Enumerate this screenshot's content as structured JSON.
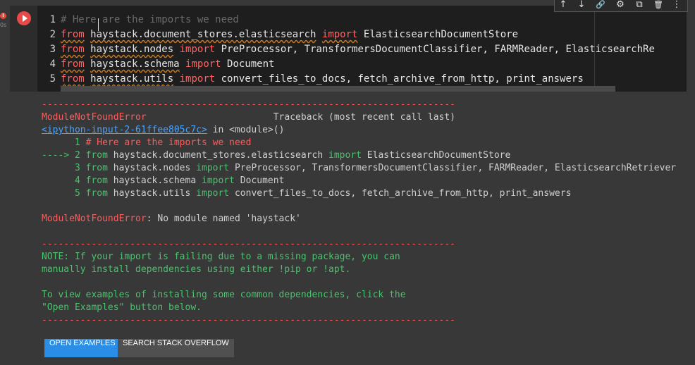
{
  "cell": {
    "warning_badge": "!",
    "exec_time": "0s",
    "code_lines": [
      {
        "num": "1",
        "parts": [
          {
            "cls": "cmt",
            "text": "# Here are the imports we need"
          }
        ]
      },
      {
        "num": "2",
        "parts": [
          {
            "cls": "kw",
            "text": "from"
          },
          {
            "cls": "id",
            "text": " "
          },
          {
            "cls": "mod",
            "text": "haystack.document_stores.elasticsearch"
          },
          {
            "cls": "id",
            "text": " "
          },
          {
            "cls": "kw",
            "text": "import"
          },
          {
            "cls": "id",
            "text": " ElasticsearchDocumentStore"
          }
        ]
      },
      {
        "num": "3",
        "parts": [
          {
            "cls": "kw",
            "text": "from"
          },
          {
            "cls": "id",
            "text": " "
          },
          {
            "cls": "mod",
            "text": "haystack.nodes"
          },
          {
            "cls": "id",
            "text": " "
          },
          {
            "cls": "kw2",
            "text": "import"
          },
          {
            "cls": "id",
            "text": " PreProcessor, TransformersDocumentClassifier, FARMReader, ElasticsearchRe"
          }
        ]
      },
      {
        "num": "4",
        "parts": [
          {
            "cls": "kw",
            "text": "from"
          },
          {
            "cls": "id",
            "text": " "
          },
          {
            "cls": "mod",
            "text": "haystack.schema"
          },
          {
            "cls": "id",
            "text": " "
          },
          {
            "cls": "kw2",
            "text": "import"
          },
          {
            "cls": "id",
            "text": " Document"
          }
        ]
      },
      {
        "num": "5",
        "parts": [
          {
            "cls": "kw",
            "text": "from"
          },
          {
            "cls": "id",
            "text": " "
          },
          {
            "cls": "mod",
            "text": "haystack.utils"
          },
          {
            "cls": "id",
            "text": " "
          },
          {
            "cls": "kw2",
            "text": "import"
          },
          {
            "cls": "id",
            "text": " convert_files_to_docs, fetch_archive_from_http, print_answers"
          }
        ]
      }
    ]
  },
  "toolbar": {
    "move_up": "↑",
    "move_down": "↓",
    "link": "🔗",
    "settings": "⚙",
    "mirror": "⧉",
    "delete": "🗑",
    "more": "⋮"
  },
  "output": {
    "lines": [
      {
        "parts": [
          {
            "cls": "red",
            "text": "---------------------------------------------------------------------------"
          }
        ]
      },
      {
        "parts": [
          {
            "cls": "red",
            "text": "ModuleNotFoundError"
          },
          {
            "cls": "gray",
            "text": "                       Traceback (most recent call last)"
          }
        ]
      },
      {
        "parts": [
          {
            "cls": "link",
            "text": "<ipython-input-2-61ffee805c7c>"
          },
          {
            "cls": "gray",
            "text": " in "
          },
          {
            "cls": "gray",
            "text": "<module>()"
          }
        ]
      },
      {
        "parts": [
          {
            "cls": "green",
            "text": "      1 "
          },
          {
            "cls": "red",
            "text": "# Here are the imports we need"
          }
        ]
      },
      {
        "parts": [
          {
            "cls": "green",
            "text": "----> 2 "
          },
          {
            "cls": "kwout",
            "text": "from"
          },
          {
            "cls": "gray",
            "text": " haystack.document_stores.elasticsearch "
          },
          {
            "cls": "kwout",
            "text": "import"
          },
          {
            "cls": "gray",
            "text": " ElasticsearchDocumentStore"
          }
        ]
      },
      {
        "parts": [
          {
            "cls": "green",
            "text": "      3 "
          },
          {
            "cls": "kwout",
            "text": "from"
          },
          {
            "cls": "gray",
            "text": " haystack.nodes "
          },
          {
            "cls": "kwout",
            "text": "import"
          },
          {
            "cls": "gray",
            "text": " PreProcessor, TransformersDocumentClassifier, FARMReader, ElasticsearchRetriever"
          }
        ]
      },
      {
        "parts": [
          {
            "cls": "green",
            "text": "      4 "
          },
          {
            "cls": "kwout",
            "text": "from"
          },
          {
            "cls": "gray",
            "text": " haystack.schema "
          },
          {
            "cls": "kwout",
            "text": "import"
          },
          {
            "cls": "gray",
            "text": " Document"
          }
        ]
      },
      {
        "parts": [
          {
            "cls": "green",
            "text": "      5 "
          },
          {
            "cls": "kwout",
            "text": "from"
          },
          {
            "cls": "gray",
            "text": " haystack.utils "
          },
          {
            "cls": "kwout",
            "text": "import"
          },
          {
            "cls": "gray",
            "text": " convert_files_to_docs, fetch_archive_from_http, print_answers"
          }
        ]
      },
      {
        "parts": [
          {
            "cls": "gray",
            "text": ""
          }
        ]
      },
      {
        "parts": [
          {
            "cls": "red",
            "text": "ModuleNotFoundError"
          },
          {
            "cls": "gray",
            "text": ": No module named 'haystack'"
          }
        ]
      },
      {
        "parts": [
          {
            "cls": "gray",
            "text": ""
          }
        ]
      },
      {
        "parts": [
          {
            "cls": "red",
            "text": "---------------------------------------------------------------------------"
          }
        ]
      },
      {
        "parts": [
          {
            "cls": "green",
            "text": "NOTE: If your import is failing due to a missing package, you can"
          }
        ]
      },
      {
        "parts": [
          {
            "cls": "green",
            "text": "manually install dependencies using either !pip or !apt."
          }
        ]
      },
      {
        "parts": [
          {
            "cls": "gray",
            "text": ""
          }
        ]
      },
      {
        "parts": [
          {
            "cls": "green",
            "text": "To view examples of installing some common dependencies, click the"
          }
        ]
      },
      {
        "parts": [
          {
            "cls": "green",
            "text": "\"Open Examples\" button below."
          }
        ]
      },
      {
        "parts": [
          {
            "cls": "red",
            "text": "---------------------------------------------------------------------------"
          }
        ]
      }
    ],
    "open_examples_label": "OPEN EXAMPLES",
    "search_so_label": "SEARCH STACK OVERFLOW"
  },
  "colors": {
    "accent_button": "#2b8ee6",
    "secondary_button": "#505050"
  }
}
